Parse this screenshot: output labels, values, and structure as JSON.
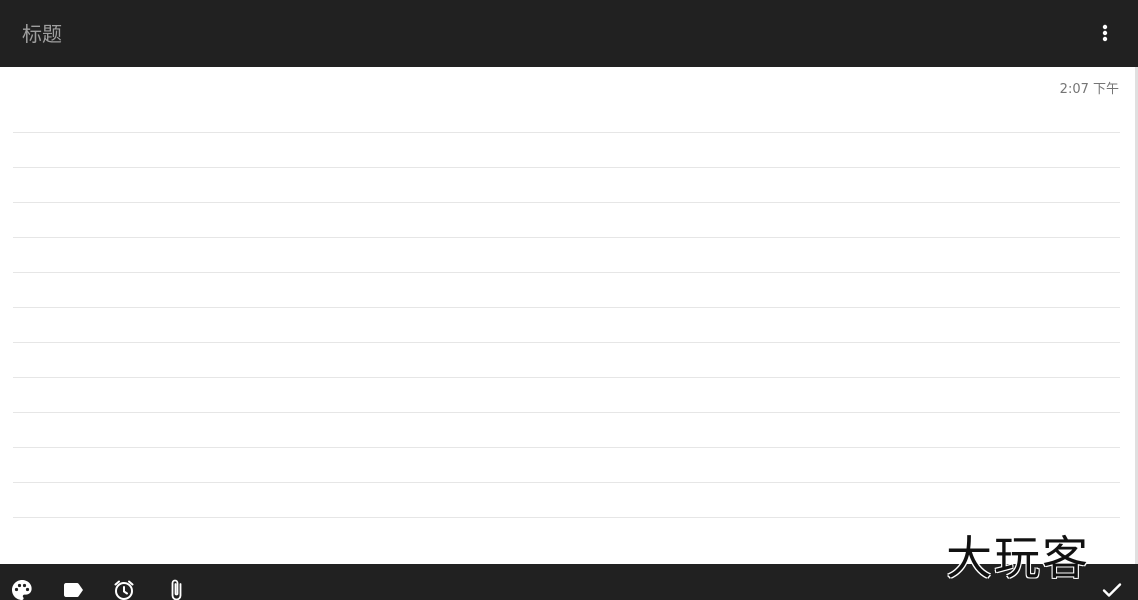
{
  "header": {
    "title_placeholder": "标题",
    "overflow_icon": "more-vert-icon"
  },
  "note": {
    "timestamp": "2:07 下午",
    "body": ""
  },
  "toolbar": {
    "items": [
      {
        "icon": "palette-icon"
      },
      {
        "icon": "label-icon"
      },
      {
        "icon": "alarm-icon"
      },
      {
        "icon": "attach-icon"
      }
    ],
    "done_icon": "check-icon"
  },
  "watermark": {
    "text": "大玩客"
  },
  "colors": {
    "bar": "#212121",
    "title_hint": "#9e9e9e",
    "timestamp": "#757575",
    "rule_line": "#e6e6e6",
    "icon": "#ffffff"
  }
}
